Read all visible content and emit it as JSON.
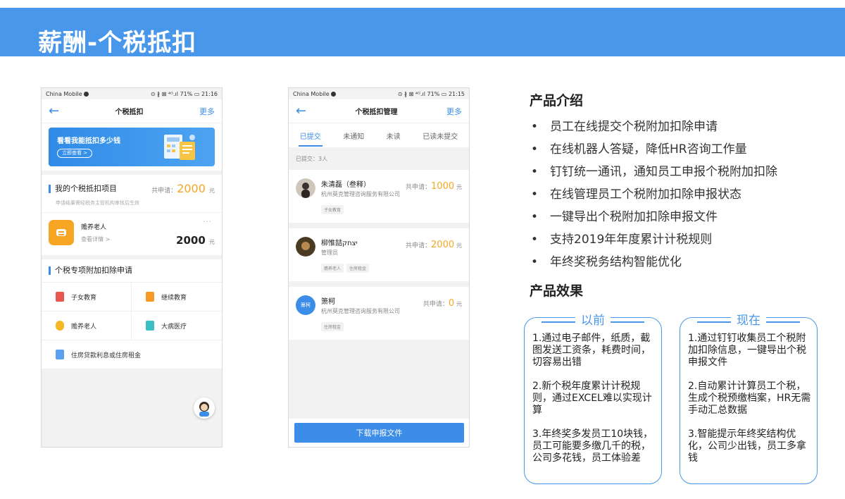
{
  "header": {
    "title": "薪酬-个税抵扣"
  },
  "phone1": {
    "status": {
      "carrier": "China Mobile",
      "right": "⊙ ∦ ⊠ ⁴ᴳ.ıl 71% ▭ 21:16"
    },
    "nav": {
      "back": "←",
      "title": "个税抵扣",
      "more": "更多"
    },
    "promo": {
      "title": "看看我能抵扣多少钱",
      "button": "立即查看 >"
    },
    "my_items": {
      "title": "我的个税抵扣项目",
      "total_label": "共申请：",
      "total_value": "2000",
      "unit": "元",
      "note": "申请结果需经税务主管机构审核后生效"
    },
    "item": {
      "name": "赡养老人",
      "link": "查看详情 >",
      "dots": "···",
      "amount": "2000",
      "unit": "元"
    },
    "apply": {
      "title": "个税专项附加扣除申请",
      "options": [
        "子女教育",
        "继续教育",
        "赡养老人",
        "大病医疗",
        "住房贷款利息或住房租金"
      ]
    }
  },
  "phone2": {
    "status": {
      "carrier": "China Mobile",
      "right": "⊙ ∦ ⊠ ⁴ᴳ.ıl 71% ▭ 21:15"
    },
    "nav": {
      "back": "←",
      "title": "个税抵扣管理",
      "more": "更多"
    },
    "tabs": [
      "已提交",
      "未通知",
      "未读",
      "已读未提交"
    ],
    "count_line": "已提交：3人",
    "employees": [
      {
        "name": "朱清磊（叁释）",
        "company": "杭州莫克管理咨询服务有限公司",
        "total_label": "共申请：",
        "total": "1000",
        "unit": "元",
        "tags": [
          "子女教育"
        ]
      },
      {
        "name": "柳惟喆יצחק",
        "company": "管理员",
        "total_label": "共申请：",
        "total": "2000",
        "unit": "元",
        "tags": [
          "赡养老人",
          "住房租金"
        ]
      },
      {
        "name": "箫柯",
        "company": "杭州莫克管理咨询服务有限公司",
        "total_label": "共申请：",
        "total": "0",
        "unit": "元",
        "tags": [
          "住房租金"
        ],
        "avatar_text": "箫柯"
      }
    ],
    "download": "下载申报文件"
  },
  "intro": {
    "title": "产品介绍",
    "bullet": "•",
    "features": [
      "员工在线提交个税附加扣除申请",
      "在线机器人答疑，降低HR咨询工作量",
      "钉钉统一通讯，通知员工申报个税附加扣除",
      "在线管理员工个税附加扣除申报状态",
      "一键导出个税附加扣除申报文件",
      "支持2019年年度累计计税规则",
      "年终奖税务结构智能优化"
    ]
  },
  "effect": {
    "title": "产品效果",
    "before": {
      "title": "以前",
      "points": [
        "1.通过电子邮件，纸质，截图发送工资条，耗费时间，切容易出错",
        "2.新个税年度累计计税规则，通过EXCEL难以实现计算",
        "3.年终奖多发员工10块钱，员工可能要多缴几千的税，公司多花钱，员工体验差"
      ]
    },
    "after": {
      "title": "现在",
      "points": [
        "1.通过钉钉收集员工个税附加扣除信息，一键导出个税申报文件",
        "2.自动累计计算员工个税，生成个税预缴档案，HR无需手动汇总数据",
        "3.智能提示年终奖结构优化，公司少出钱，员工多拿钱"
      ]
    }
  },
  "colors": {
    "banner": "#4897ea",
    "accent": "#3b8de8",
    "amount": "#f7a623"
  }
}
